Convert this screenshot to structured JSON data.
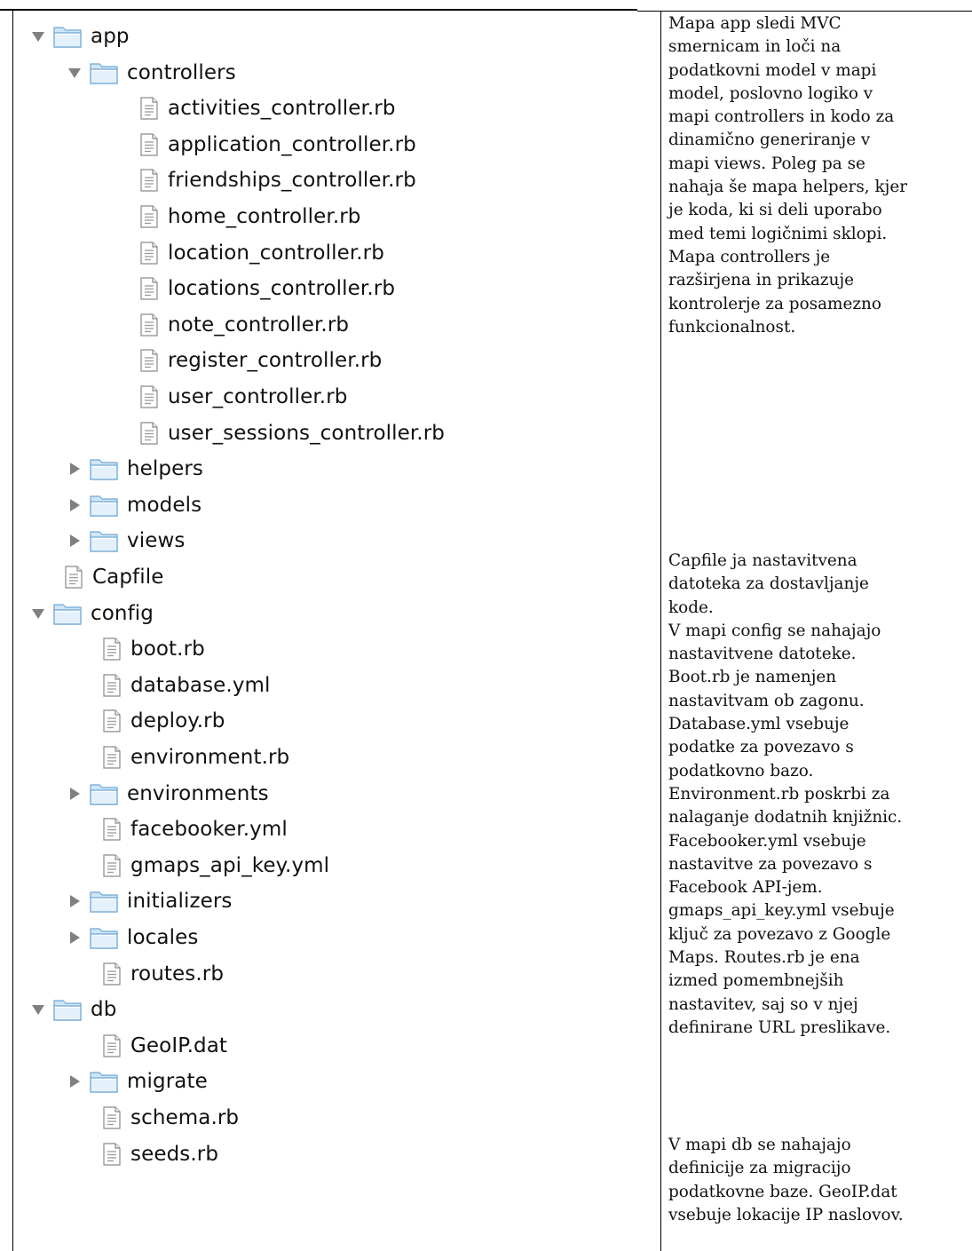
{
  "icons": {
    "folder": "folder-icon",
    "file": "file-icon",
    "expanded": "triangle-down-icon",
    "collapsed": "triangle-right-icon"
  },
  "colors": {
    "folder_light": "#cfe6f7",
    "folder_dark": "#6ea7d3",
    "triangle": "#808080",
    "text": "#111111"
  },
  "tree": [
    {
      "label": "app",
      "type": "folder",
      "state": "expanded",
      "depth": 0
    },
    {
      "label": "controllers",
      "type": "folder",
      "state": "expanded",
      "depth": 1
    },
    {
      "label": "activities_controller.rb",
      "type": "file",
      "depth": 2
    },
    {
      "label": "application_controller.rb",
      "type": "file",
      "depth": 2
    },
    {
      "label": "friendships_controller.rb",
      "type": "file",
      "depth": 2
    },
    {
      "label": "home_controller.rb",
      "type": "file",
      "depth": 2
    },
    {
      "label": "location_controller.rb",
      "type": "file",
      "depth": 2
    },
    {
      "label": "locations_controller.rb",
      "type": "file",
      "depth": 2
    },
    {
      "label": "note_controller.rb",
      "type": "file",
      "depth": 2
    },
    {
      "label": "register_controller.rb",
      "type": "file",
      "depth": 2
    },
    {
      "label": "user_controller.rb",
      "type": "file",
      "depth": 2
    },
    {
      "label": "user_sessions_controller.rb",
      "type": "file",
      "depth": 2
    },
    {
      "label": "helpers",
      "type": "folder",
      "state": "collapsed",
      "depth": 1
    },
    {
      "label": "models",
      "type": "folder",
      "state": "collapsed",
      "depth": 1
    },
    {
      "label": "views",
      "type": "folder",
      "state": "collapsed",
      "depth": 1
    },
    {
      "label": "Capfile",
      "type": "file",
      "depth": 0
    },
    {
      "label": "config",
      "type": "folder",
      "state": "expanded",
      "depth": 0
    },
    {
      "label": "boot.rb",
      "type": "file",
      "depth": 1
    },
    {
      "label": "database.yml",
      "type": "file",
      "depth": 1
    },
    {
      "label": "deploy.rb",
      "type": "file",
      "depth": 1
    },
    {
      "label": "environment.rb",
      "type": "file",
      "depth": 1
    },
    {
      "label": "environments",
      "type": "folder",
      "state": "collapsed",
      "depth": 1
    },
    {
      "label": "facebooker.yml",
      "type": "file",
      "depth": 1
    },
    {
      "label": "gmaps_api_key.yml",
      "type": "file",
      "depth": 1
    },
    {
      "label": "initializers",
      "type": "folder",
      "state": "collapsed",
      "depth": 1
    },
    {
      "label": "locales",
      "type": "folder",
      "state": "collapsed",
      "depth": 1
    },
    {
      "label": "routes.rb",
      "type": "file",
      "depth": 1
    },
    {
      "label": "db",
      "type": "folder",
      "state": "expanded",
      "depth": 0
    },
    {
      "label": "GeoIP.dat",
      "type": "file",
      "depth": 1
    },
    {
      "label": "migrate",
      "type": "folder",
      "state": "collapsed",
      "depth": 1
    },
    {
      "label": "schema.rb",
      "type": "file",
      "depth": 1
    },
    {
      "label": "seeds.rb",
      "type": "file",
      "depth": 1
    }
  ],
  "notes": {
    "app": "Mapa app sledi MVC\nsmernicam in loči na\npodatkovni model v mapi\nmodel, poslovno logiko v\nmapi controllers in kodo za\ndinamično generiranje v\nmapi views.  Poleg pa se\nnahaja še mapa helpers, kjer\nje koda, ki si deli uporabo\nmed temi logičnimi sklopi.\nMapa controllers je\nrazširjena in prikazuje\nkontrolerje za posamezno\nfunkcionalnost.",
    "config": "Capfile ja nastavitvena\ndatoteka za dostavljanje\nkode.\nV mapi config se nahajajo\nnastavitvene datoteke.\nBoot.rb je namenjen\nnastavitvam ob zagonu.\nDatabase.yml vsebuje\npodatke za povezavo s\npodatkovno bazo.\nEnvironment.rb poskrbi za\nnalaganje dodatnih knjižnic.\nFacebooker.yml vsebuje\nnastavitve za povezavo s\nFacebook API-jem.\ngmaps_api_key.yml vsebuje\nključ za povezavo z Google\nMaps. Routes.rb je ena\nizmed pomembnejših\nnastavitev, saj so v njej\ndefinirane URL preslikave.",
    "db": "V mapi db se nahajajo\ndefinicije za migracijo\npodatkovne baze. GeoIP.dat\nvsebuje lokacije IP naslovov."
  }
}
